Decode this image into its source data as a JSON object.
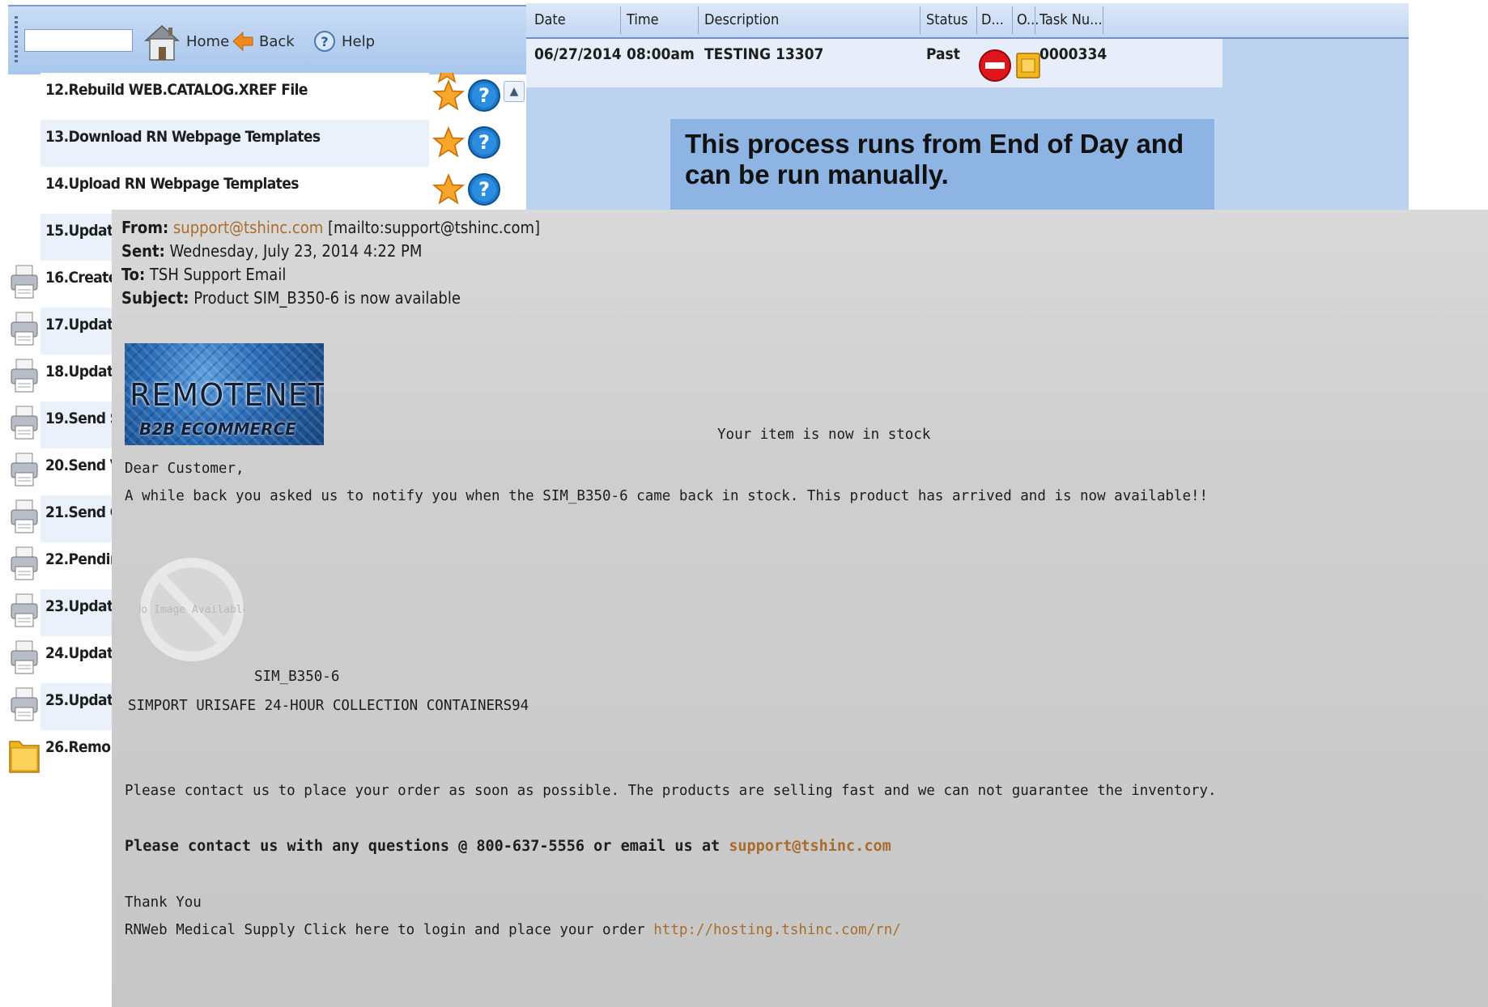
{
  "toolbar": {
    "search_value": "",
    "home_label": "Home",
    "back_label": "Back",
    "help_label": "Help"
  },
  "tasks": [
    {
      "label": "12.Rebuild WEB.CATALOG.XREF File",
      "icon": "none"
    },
    {
      "label": "13.Download RN Webpage Templates",
      "icon": "none"
    },
    {
      "label": "14.Upload RN Webpage Templates",
      "icon": "none"
    },
    {
      "label": "15.Updat",
      "icon": "none"
    },
    {
      "label": "16.Create",
      "icon": "printer-icon"
    },
    {
      "label": "17.Updat",
      "icon": "printer-icon"
    },
    {
      "label": "18.Updat",
      "icon": "printer-icon"
    },
    {
      "label": "19.Send S",
      "icon": "printer-icon"
    },
    {
      "label": "20.Send V",
      "icon": "printer-icon"
    },
    {
      "label": "21.Send C",
      "icon": "printer-icon"
    },
    {
      "label": "22.Pendir",
      "icon": "printer-icon"
    },
    {
      "label": "23.Updat",
      "icon": "printer-icon"
    },
    {
      "label": "24.Updat",
      "icon": "printer-icon"
    },
    {
      "label": "25.Updat",
      "icon": "printer-icon"
    },
    {
      "label": "26.Remo",
      "icon": "folder-icon"
    }
  ],
  "grid": {
    "columns": [
      "Date",
      "Time",
      "Description",
      "Status",
      "D...",
      "O...",
      "Task Nu..."
    ],
    "row": {
      "date": "06/27/2014",
      "time": "08:00am",
      "description": "TESTING 13307",
      "status": "Past",
      "task_number": "0000334"
    }
  },
  "callout": "This process runs from End of Day and can be run manually.",
  "email": {
    "from_label": "From:",
    "from_value": "support@tshinc.com",
    "from_mailto": "[mailto:support@tshinc.com]",
    "sent_label": "Sent:",
    "sent_value": "Wednesday, July 23, 2014 4:22 PM",
    "to_label": "To:",
    "to_value": "TSH Support Email",
    "subject_label": "Subject:",
    "subject_value": "Product SIM_B350-6 is now available",
    "logo_title": "REMOTENET",
    "logo_subtitle": "B2B ECOMMERCE",
    "in_stock": "Your item is now in stock",
    "greeting": "Dear Customer,",
    "body_line": "A while back you asked us to notify you when the SIM_B350-6 came back in stock. This product has arrived and is now available!!",
    "no_image_text": "No Image Available",
    "product_code": "SIM_B350-6",
    "product_name": "SIMPORT URISAFE 24-HOUR COLLECTION CONTAINERS94",
    "contact_line": "Please contact us to place your order as soon as possible. The products are selling fast and we can not guarantee the inventory.",
    "questions_line": "Please contact us with any questions @ 800-637-5556 or email us at",
    "questions_email": "support@tshinc.com",
    "thank_you": "Thank You",
    "login_line": "RNWeb Medical Supply Click here to login and place your order",
    "login_url": "http://hosting.tshinc.com/rn/"
  },
  "colors": {
    "toolbar_bg": "#a8c6ee",
    "callout_bg": "#8eb4e3",
    "link": "#a86c2c",
    "email_bg": "#cfcfcf"
  }
}
